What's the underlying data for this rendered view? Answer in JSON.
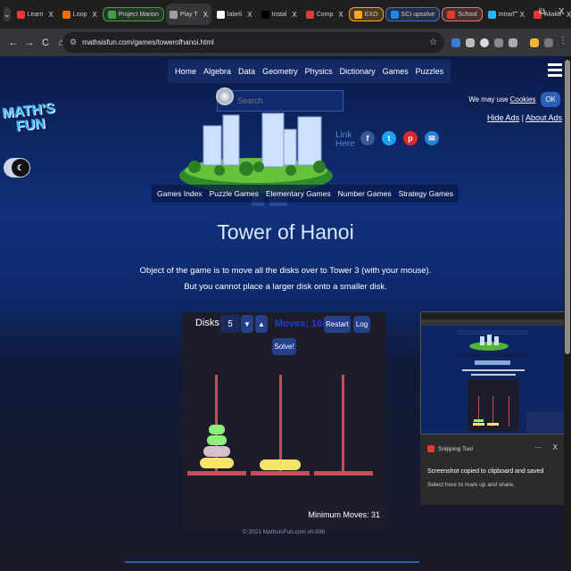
{
  "browser": {
    "tabs": [
      {
        "label": "Learn",
        "fav": "#e53935",
        "active": false
      },
      {
        "label": "Loop",
        "fav": "#ef6c00",
        "active": false
      },
      {
        "label": "Project Marion",
        "fav": "#43a047",
        "group": "#43a047",
        "active": false
      },
      {
        "label": "Play T",
        "fav": "#9e9e9e",
        "active": true
      },
      {
        "label": "labeli",
        "fav": "#fff",
        "active": false
      },
      {
        "label": "Instal",
        "fav": "#000",
        "active": false
      },
      {
        "label": "Comp",
        "fav": "#e53935",
        "active": false
      },
      {
        "label": "EXO",
        "fav": "#f9a825",
        "group": "#f9a825",
        "active": false
      },
      {
        "label": "SCI upsolve",
        "fav": "#1e88e5",
        "group": "#3f6fd8",
        "active": false
      },
      {
        "label": "School",
        "fav": "#e53935",
        "group": "#e57373",
        "active": false
      },
      {
        "label": "Intran",
        "fav": "#29b6f6",
        "active": false
      },
      {
        "label": "Aliakb",
        "fav": "#e53935",
        "active": false
      }
    ],
    "tab_close": "X",
    "new_tab": "+",
    "window_controls": {
      "minimize": "–",
      "restore": "⧉",
      "close": "X"
    },
    "nav": {
      "back": "←",
      "forward": "→",
      "reload": "C",
      "home": "⌂"
    },
    "url": "mathsisfun.com/games/towerofhanoi.html",
    "bookmark_icon": "star-icon"
  },
  "site": {
    "topnav": [
      "Home",
      "Algebra",
      "Data",
      "Geometry",
      "Physics",
      "Dictionary",
      "Games",
      "Puzzles"
    ],
    "search_placeholder": "Search",
    "cookie": {
      "text": "We may use",
      "link": "Cookies",
      "ok": "OK"
    },
    "ad_links": {
      "hide": "Hide Ads",
      "sep": "|",
      "about": "About Ads"
    },
    "logo": {
      "line1": "MATH'S",
      "line2": "FUN"
    },
    "link_here": {
      "line1": "Link",
      "line2": "Here"
    },
    "social": [
      {
        "label": "f",
        "color": "#3b5998"
      },
      {
        "label": "t",
        "color": "#1da1f2"
      },
      {
        "label": "p",
        "color": "#e02828"
      },
      {
        "label": "✉",
        "color": "#2a7fd8"
      }
    ],
    "category_nav": [
      "Games Index",
      "Puzzle Games",
      "Elementary Games",
      "Number Games",
      "Strategy Games"
    ],
    "title": "Tower of Hanoi",
    "desc_line1": "Object of the game is to move all the disks over to Tower 3 (with your mouse).",
    "desc_line2": "But you cannot place a larger disk onto a smaller disk."
  },
  "game": {
    "disks_label": "Disks:",
    "disks_value": "5",
    "down_label": "▼",
    "up_label": "▲",
    "moves_label": "Moves: 104",
    "restart_label": "Restart",
    "log_label": "Log",
    "solve_label": "Solve!",
    "min_moves_label": "Minimum Moves: 31",
    "copyright": "© 2021 MathsIsFun.com v0.936",
    "colors": {
      "peg": "#c94b57",
      "disk_green": "#8cf07a",
      "disk_pink": "#d8c0cc",
      "disk_yellow": "#f7e56a"
    }
  },
  "snipping": {
    "app": "Snipping Tool",
    "dots": "···",
    "close": "X",
    "message": "Screenshot copied to clipboard and saved",
    "sub": "Select here to mark up and share."
  }
}
